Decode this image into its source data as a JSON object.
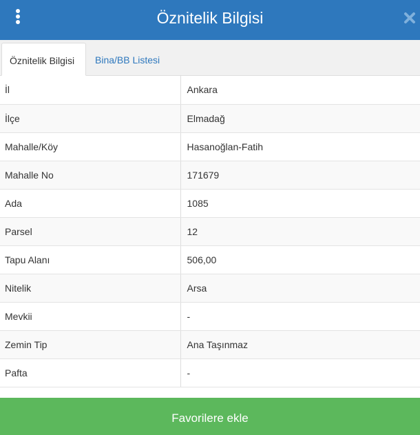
{
  "header": {
    "title": "Öznitelik Bilgisi"
  },
  "icons": {
    "menu": "vertical-ellipsis",
    "close": "close-x"
  },
  "tabs": [
    {
      "label": "Öznitelik Bilgisi",
      "active": true
    },
    {
      "label": "Bina/BB Listesi",
      "active": false
    }
  ],
  "rows": [
    {
      "key": "İl",
      "value": "Ankara"
    },
    {
      "key": "İlçe",
      "value": "Elmadağ"
    },
    {
      "key": "Mahalle/Köy",
      "value": "Hasanoğlan-Fatih"
    },
    {
      "key": "Mahalle No",
      "value": "171679"
    },
    {
      "key": "Ada",
      "value": "1085"
    },
    {
      "key": "Parsel",
      "value": "12"
    },
    {
      "key": "Tapu Alanı",
      "value": "506,00"
    },
    {
      "key": "Nitelik",
      "value": "Arsa"
    },
    {
      "key": "Mevkii",
      "value": "-"
    },
    {
      "key": "Zemin Tip",
      "value": "Ana Taşınmaz"
    },
    {
      "key": "Pafta",
      "value": "-"
    }
  ],
  "footer": {
    "favorite_label": "Favorilere ekle"
  },
  "colors": {
    "header_bg": "#2e78bd",
    "tab_link": "#2e78bd",
    "button_bg": "#5cb85c"
  }
}
